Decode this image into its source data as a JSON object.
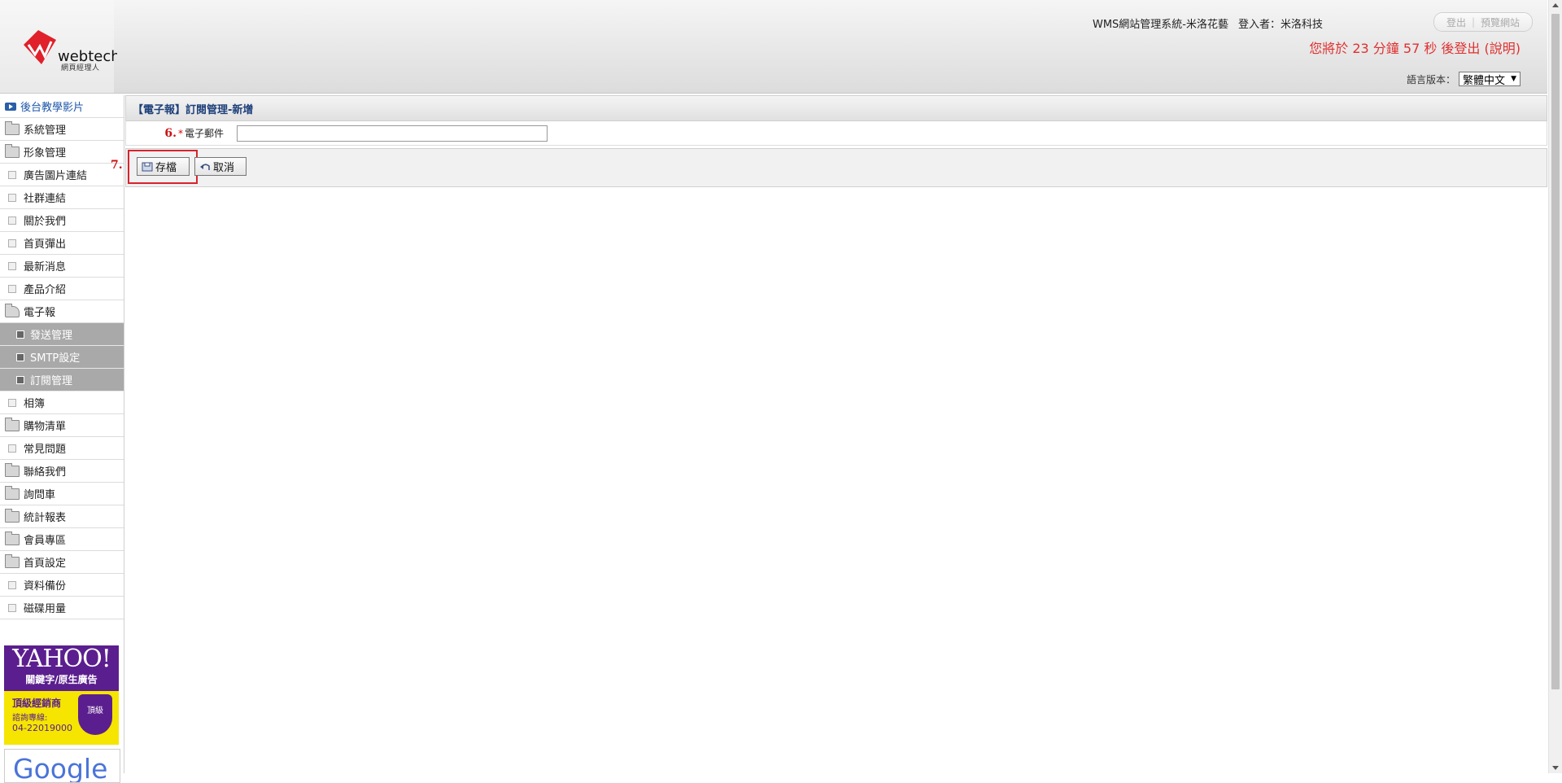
{
  "header": {
    "logo_text": "webtech",
    "logo_subtext": "網頁經理人",
    "system_name": "WMS網站管理系統-米洛花藝",
    "login_user": "登入者：米洛科技",
    "logout_label": "登出",
    "preview_label": "預覽網站",
    "logout_timer": "您將於 23 分鐘 57 秒 後登出 (說明)",
    "language_label": "語言版本：",
    "language_value": "繁體中文"
  },
  "sidebar": {
    "items": [
      {
        "label": "後台教學影片",
        "icon": "video-icon"
      },
      {
        "label": "系統管理",
        "icon": "folder-icon"
      },
      {
        "label": "形象管理",
        "icon": "folder-icon"
      },
      {
        "label": "廣告圖片連結",
        "icon": "square-icon"
      },
      {
        "label": "社群連結",
        "icon": "square-icon"
      },
      {
        "label": "關於我們",
        "icon": "square-icon"
      },
      {
        "label": "首頁彈出",
        "icon": "square-icon"
      },
      {
        "label": "最新消息",
        "icon": "square-icon"
      },
      {
        "label": "產品介紹",
        "icon": "square-icon"
      },
      {
        "label": "電子報",
        "icon": "folder-open-icon"
      },
      {
        "label": "相簿",
        "icon": "square-icon"
      },
      {
        "label": "購物清單",
        "icon": "folder-icon"
      },
      {
        "label": "常見問題",
        "icon": "square-icon"
      },
      {
        "label": "聯絡我們",
        "icon": "folder-icon"
      },
      {
        "label": "詢問車",
        "icon": "folder-icon"
      },
      {
        "label": "統計報表",
        "icon": "folder-icon"
      },
      {
        "label": "會員專區",
        "icon": "folder-icon"
      },
      {
        "label": "首頁設定",
        "icon": "folder-icon"
      },
      {
        "label": "資料備份",
        "icon": "square-icon"
      },
      {
        "label": "磁碟用量",
        "icon": "square-icon"
      }
    ],
    "sub_items": [
      {
        "label": "發送管理"
      },
      {
        "label": "SMTP設定"
      },
      {
        "label": "訂閱管理"
      }
    ],
    "ads": {
      "yahoo_brand": "YAHOO!",
      "yahoo_sub": "關鍵字/原生廣告",
      "yahoo_line1": "頂級經銷商",
      "yahoo_line2": "諮詢專線:",
      "yahoo_phone": "04-22019000",
      "yahoo_badge": "頂級",
      "google_brand": "Google"
    }
  },
  "main": {
    "title": "【電子報】訂閱管理-新增",
    "step6": "6.",
    "required_mark": "*",
    "email_label": "電子郵件",
    "email_value": "",
    "step7": "7.",
    "save_label": "存檔",
    "cancel_label": "取消"
  },
  "colors": {
    "accent_red": "#d9232d",
    "title_blue": "#1d3f7a",
    "timer_red": "#e03030",
    "submenu_gray": "#a9a9a9"
  }
}
